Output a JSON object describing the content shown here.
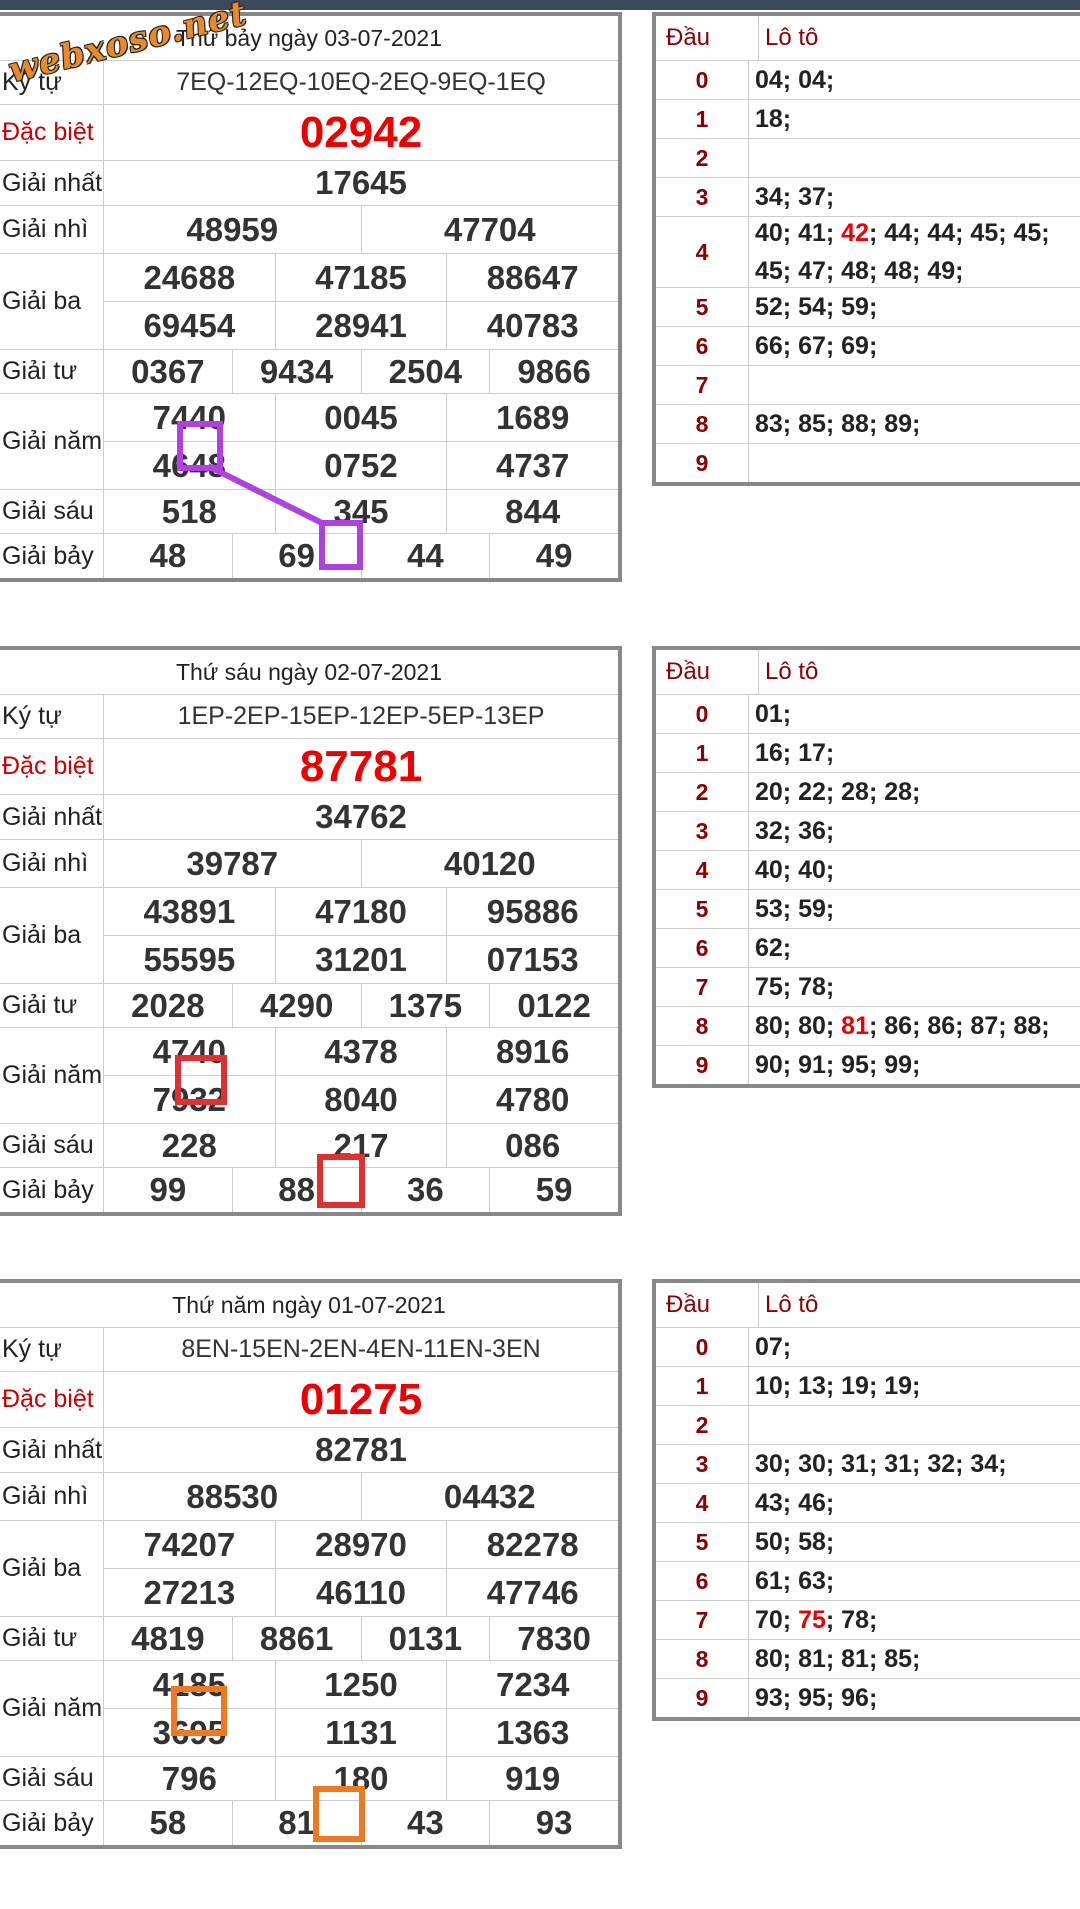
{
  "watermark": "webxoso.net",
  "days": [
    {
      "title": "Thứ bảy ngày 03-07-2021",
      "ky_tu_label": "Ký tự",
      "ky_tu": "7EQ-12EQ-10EQ-2EQ-9EQ-1EQ",
      "labels": [
        "Đặc biệt",
        "Giải nhất",
        "Giải nhì",
        "Giải ba",
        "Giải tư",
        "Giải năm",
        "Giải sáu",
        "Giải bảy"
      ],
      "dac_biet": "02942",
      "giai_nhat": "17645",
      "giai_nhi": [
        "48959",
        "47704"
      ],
      "giai_ba": [
        "24688",
        "47185",
        "88647",
        "69454",
        "28941",
        "40783"
      ],
      "giai_tu": [
        "0367",
        "9434",
        "2504",
        "9866"
      ],
      "giai_nam": [
        "7440",
        "0045",
        "1689",
        "4648",
        "0752",
        "4737"
      ],
      "giai_sau": [
        "518",
        "345",
        "844"
      ],
      "giai_bay": [
        "48",
        "69",
        "44",
        "49"
      ],
      "loto_head": [
        "Đầu",
        "Lô tô"
      ],
      "loto": [
        {
          "d": "0",
          "v": "04; 04;"
        },
        {
          "d": "1",
          "v": "18;"
        },
        {
          "d": "2",
          "v": ""
        },
        {
          "d": "3",
          "v": "34; 37;"
        },
        {
          "d": "4",
          "v_pre": "40; 41; ",
          "v_hl": "42",
          "v_post": "; 44; 44; 45; 45; 45; 47; 48; 48; 49;"
        },
        {
          "d": "5",
          "v": "52; 54; 59;"
        },
        {
          "d": "6",
          "v": "66; 67; 69;"
        },
        {
          "d": "7",
          "v": ""
        },
        {
          "d": "8",
          "v": "83; 85; 88; 89;"
        },
        {
          "d": "9",
          "v": ""
        }
      ]
    },
    {
      "title": "Thứ sáu ngày 02-07-2021",
      "ky_tu_label": "Ký tự",
      "ky_tu": "1EP-2EP-15EP-12EP-5EP-13EP",
      "labels": [
        "Đặc biệt",
        "Giải nhất",
        "Giải nhì",
        "Giải ba",
        "Giải tư",
        "Giải năm",
        "Giải sáu",
        "Giải bảy"
      ],
      "dac_biet": "87781",
      "giai_nhat": "34762",
      "giai_nhi": [
        "39787",
        "40120"
      ],
      "giai_ba": [
        "43891",
        "47180",
        "95886",
        "55595",
        "31201",
        "07153"
      ],
      "giai_tu": [
        "2028",
        "4290",
        "1375",
        "0122"
      ],
      "giai_nam": [
        "4740",
        "4378",
        "8916",
        "7932",
        "8040",
        "4780"
      ],
      "giai_sau": [
        "228",
        "217",
        "086"
      ],
      "giai_bay": [
        "99",
        "88",
        "36",
        "59"
      ],
      "loto_head": [
        "Đầu",
        "Lô tô"
      ],
      "loto": [
        {
          "d": "0",
          "v": "01;"
        },
        {
          "d": "1",
          "v": "16; 17;"
        },
        {
          "d": "2",
          "v": "20; 22; 28; 28;"
        },
        {
          "d": "3",
          "v": "32; 36;"
        },
        {
          "d": "4",
          "v": "40; 40;"
        },
        {
          "d": "5",
          "v": "53; 59;"
        },
        {
          "d": "6",
          "v": "62;"
        },
        {
          "d": "7",
          "v": "75; 78;"
        },
        {
          "d": "8",
          "v_pre": "80; 80; ",
          "v_hl": "81",
          "v_post": "; 86; 86; 87; 88;"
        },
        {
          "d": "9",
          "v": "90; 91; 95; 99;"
        }
      ]
    },
    {
      "title": "Thứ năm ngày 01-07-2021",
      "ky_tu_label": "Ký tự",
      "ky_tu": "8EN-15EN-2EN-4EN-11EN-3EN",
      "labels": [
        "Đặc biệt",
        "Giải nhất",
        "Giải nhì",
        "Giải ba",
        "Giải tư",
        "Giải năm",
        "Giải sáu",
        "Giải bảy"
      ],
      "dac_biet": "01275",
      "giai_nhat": "82781",
      "giai_nhi": [
        "88530",
        "04432"
      ],
      "giai_ba": [
        "74207",
        "28970",
        "82278",
        "27213",
        "46110",
        "47746"
      ],
      "giai_tu": [
        "4819",
        "8861",
        "0131",
        "7830"
      ],
      "giai_nam": [
        "4185",
        "1250",
        "7234",
        "3695",
        "1131",
        "1363"
      ],
      "giai_sau": [
        "796",
        "180",
        "919"
      ],
      "giai_bay": [
        "58",
        "81",
        "43",
        "93"
      ],
      "loto_head": [
        "Đầu",
        "Lô tô"
      ],
      "loto": [
        {
          "d": "0",
          "v": "07;"
        },
        {
          "d": "1",
          "v": "10; 13; 19; 19;"
        },
        {
          "d": "2",
          "v": ""
        },
        {
          "d": "3",
          "v": "30; 30; 31; 31; 32; 34;"
        },
        {
          "d": "4",
          "v": "43; 46;"
        },
        {
          "d": "5",
          "v": "50; 58;"
        },
        {
          "d": "6",
          "v": "61; 63;"
        },
        {
          "d": "7",
          "v_pre": "70; ",
          "v_hl": "75",
          "v_post": "; 78;"
        },
        {
          "d": "8",
          "v": "80; 81; 81; 85;"
        },
        {
          "d": "9",
          "v": "93; 95; 96;"
        }
      ]
    }
  ],
  "colors": {
    "mark1": "#b040e0",
    "mark2": "#e03030",
    "mark3": "#f07820",
    "special": "#e00000"
  }
}
